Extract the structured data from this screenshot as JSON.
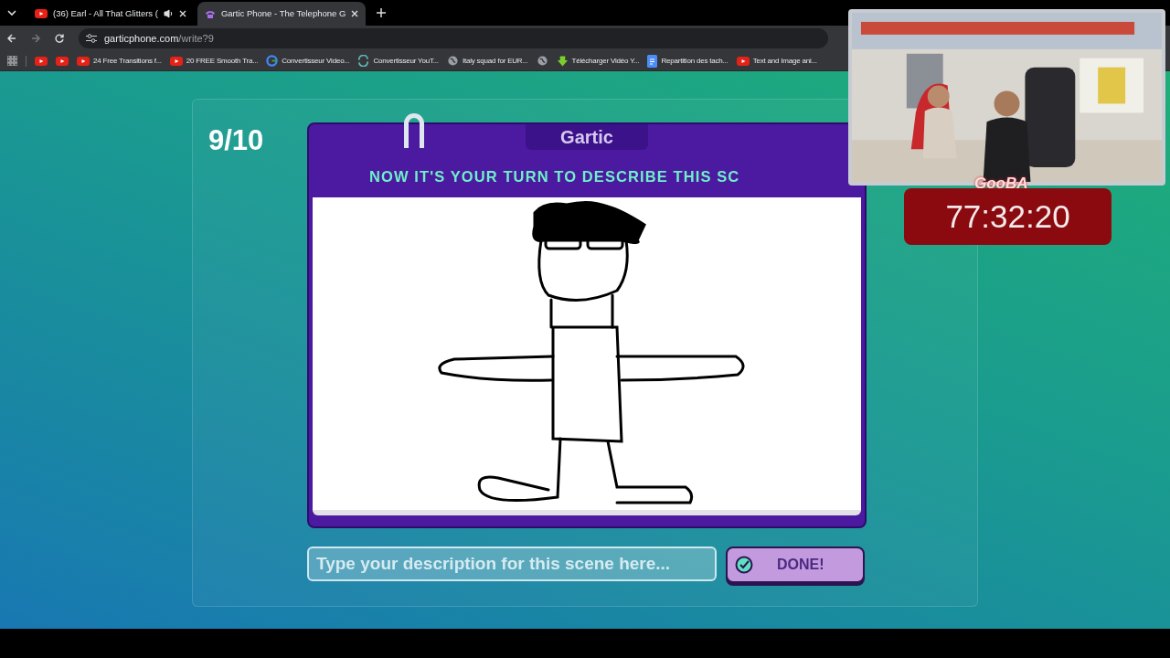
{
  "browser": {
    "tabs": [
      {
        "title": "(36) Earl - All That Glitters (",
        "selected": false,
        "audio": true
      },
      {
        "title": "Gartic Phone - The Telephone G",
        "selected": true,
        "audio": false
      }
    ],
    "address": {
      "host": "garticphone.com",
      "path": "/write?9"
    },
    "bookmarks": [
      {
        "kind": "youtube"
      },
      {
        "kind": "youtube"
      },
      {
        "label": "24 Free Transitions f...",
        "kind": "youtube"
      },
      {
        "label": "20 FREE Smooth Tra...",
        "kind": "youtube"
      },
      {
        "label": "Convertisseur Video...",
        "kind": "google"
      },
      {
        "label": "Convertisseur YouT...",
        "kind": "sync"
      },
      {
        "label": "Italy squad for EUR...",
        "kind": "globe"
      },
      {
        "kind": "globe"
      },
      {
        "label": "Télécharger Vidéo Y...",
        "kind": "download"
      },
      {
        "label": "Repartition des tach...",
        "kind": "doc"
      },
      {
        "label": "Text and Image ani...",
        "kind": "youtube"
      }
    ]
  },
  "game": {
    "round": "9/10",
    "logo": "Gartic",
    "prompt": "NOW IT'S YOUR TURN TO DESCRIBE THIS SC",
    "input": {
      "placeholder": "Type your description for this scene here..."
    },
    "done_button": "DONE!"
  },
  "stream_overlay": {
    "name": "GooBA",
    "timer": "77:32:20"
  }
}
